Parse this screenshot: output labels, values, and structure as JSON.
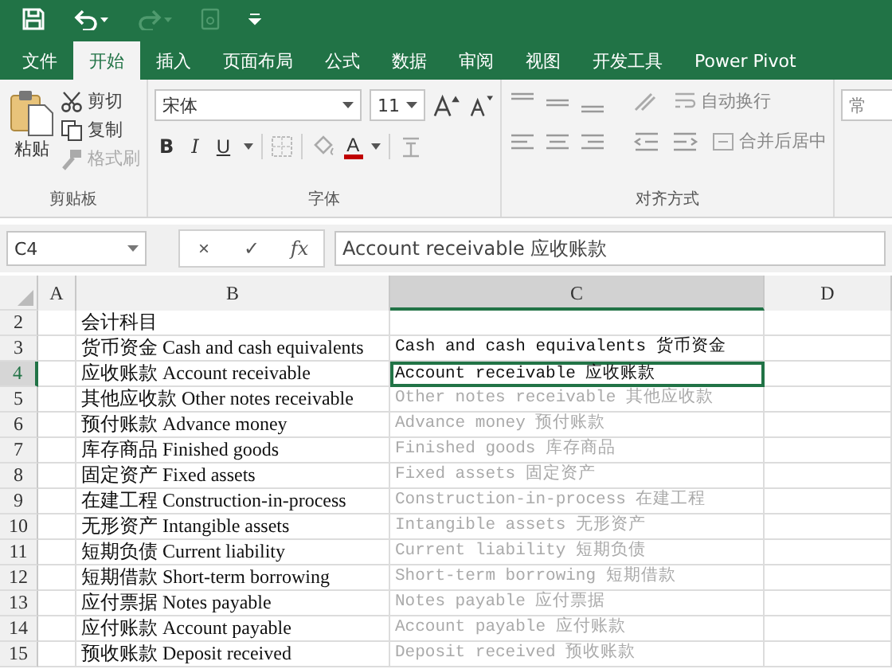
{
  "quick_access": [
    {
      "kind": "save",
      "disabled": false
    },
    {
      "kind": "undo",
      "disabled": false
    },
    {
      "kind": "redo",
      "disabled": true
    },
    {
      "kind": "touch",
      "disabled": true
    },
    {
      "kind": "customize",
      "disabled": false
    }
  ],
  "tabs": [
    {
      "label": "文件",
      "selected": false
    },
    {
      "label": "开始",
      "selected": true
    },
    {
      "label": "插入",
      "selected": false
    },
    {
      "label": "页面布局",
      "selected": false
    },
    {
      "label": "公式",
      "selected": false
    },
    {
      "label": "数据",
      "selected": false
    },
    {
      "label": "审阅",
      "selected": false
    },
    {
      "label": "视图",
      "selected": false
    },
    {
      "label": "开发工具",
      "selected": false
    },
    {
      "label": "Power Pivot",
      "selected": false
    }
  ],
  "clipboard": {
    "paste": "粘贴",
    "items": [
      {
        "kind": "cut",
        "label": "剪切",
        "disabled": false
      },
      {
        "kind": "copy",
        "label": "复制",
        "disabled": false
      },
      {
        "kind": "painter",
        "label": "格式刷",
        "disabled": true
      }
    ],
    "label": "剪贴板"
  },
  "font": {
    "font_name": "宋体",
    "font_size": "11",
    "bold": "B",
    "italic": "I",
    "underline": "U",
    "font_color": "A",
    "label": "字体"
  },
  "alignment": {
    "wrap_text": "自动换行",
    "merge_center": "合并后居中",
    "label": "对齐方式"
  },
  "number": {
    "format": "常"
  },
  "formula_bar": {
    "name_box": "C4",
    "cancel": "×",
    "enter": "✓",
    "fx": "fx",
    "value": "Account receivable 应收账款"
  },
  "columns": [
    {
      "label": "A",
      "selected": false
    },
    {
      "label": "B",
      "selected": false
    },
    {
      "label": "C",
      "selected": true
    },
    {
      "label": "D",
      "selected": false
    }
  ],
  "rows": [
    {
      "number": "2",
      "selected": false,
      "b": "会计科目"
    },
    {
      "number": "3",
      "selected": false,
      "b": "货币资金 Cash and cash equivalents",
      "c": "Cash and cash equivalents 货币资金",
      "preview": false
    },
    {
      "number": "4",
      "selected": true,
      "b": "应收账款 Account receivable",
      "c": "Account receivable 应收账款",
      "preview": false
    },
    {
      "number": "5",
      "selected": false,
      "b": "其他应收款 Other notes receivable",
      "c": "Other notes receivable 其他应收款",
      "preview": true
    },
    {
      "number": "6",
      "selected": false,
      "b": "预付账款 Advance money",
      "c": "Advance money 预付账款",
      "preview": true
    },
    {
      "number": "7",
      "selected": false,
      "b": "库存商品 Finished goods",
      "c": "Finished goods 库存商品",
      "preview": true
    },
    {
      "number": "8",
      "selected": false,
      "b": "固定资产 Fixed assets",
      "c": "Fixed assets 固定资产",
      "preview": true
    },
    {
      "number": "9",
      "selected": false,
      "b": "在建工程 Construction-in-process",
      "c": "Construction-in-process 在建工程",
      "preview": true
    },
    {
      "number": "10",
      "selected": false,
      "b": "无形资产 Intangible assets",
      "c": "Intangible assets 无形资产",
      "preview": true
    },
    {
      "number": "11",
      "selected": false,
      "b": "短期负债 Current liability",
      "c": "Current liability 短期负债",
      "preview": true
    },
    {
      "number": "12",
      "selected": false,
      "b": "短期借款 Short-term borrowing",
      "c": "Short-term borrowing 短期借款",
      "preview": true
    },
    {
      "number": "13",
      "selected": false,
      "b": "应付票据 Notes payable",
      "c": "Notes payable 应付票据",
      "preview": true
    },
    {
      "number": "14",
      "selected": false,
      "b": "应付账款 Account payable",
      "c": "Account payable 应付账款",
      "preview": true
    },
    {
      "number": "15",
      "selected": false,
      "b": "预收账款 Deposit received",
      "c": "Deposit received 预收账款",
      "preview": true
    }
  ]
}
